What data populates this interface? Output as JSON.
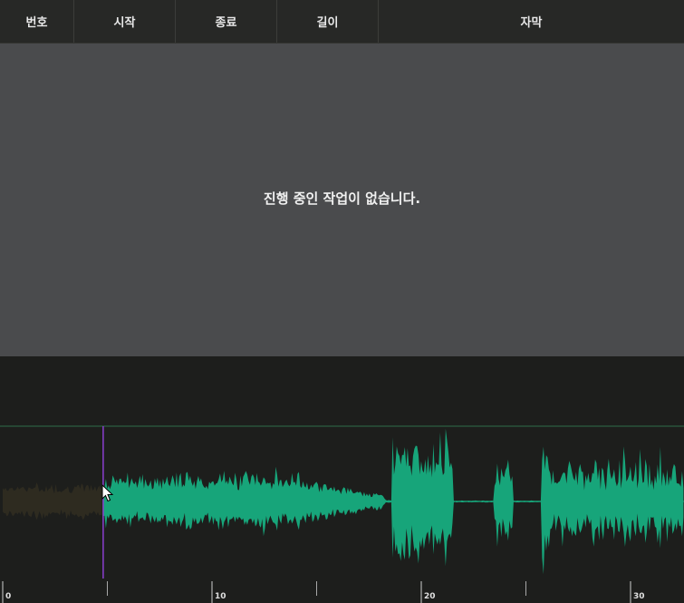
{
  "header": {
    "columns": [
      "번호",
      "시작",
      "종료",
      "길이",
      "자막"
    ]
  },
  "panel": {
    "empty_message": "진행 중인 작업이 없습니다."
  },
  "timeline": {
    "labels": [
      "0",
      "10",
      "20",
      "30"
    ],
    "major_tick_seconds": [
      0,
      10,
      20,
      30
    ],
    "minor_tick_seconds": [
      5,
      15,
      25
    ],
    "playhead_seconds": 4.8,
    "played_color": "#2e2b20",
    "wave_color": "#17a57a",
    "playhead_color": "#8a3fd0",
    "guide_color": "#2f6e4a"
  },
  "icons": {
    "cursor": "mouse-pointer-icon"
  }
}
